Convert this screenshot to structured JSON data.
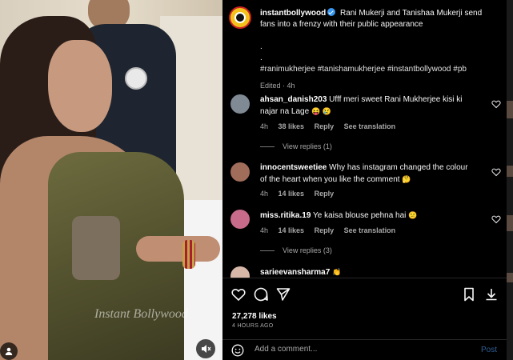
{
  "media": {
    "watermark": "Instant Bollywood"
  },
  "post": {
    "username": "instantbollywood",
    "caption": "Rani Mukerji and Tanishaa Mukerji send fans into a frenzy with their public appearance",
    "dots": [
      ".",
      "."
    ],
    "hashtags": "#ranimukherjee #tanishamukherjee #instantbollywood #pb",
    "edited": "Edited · 4h"
  },
  "comments": [
    {
      "username": "ahsan_danish203",
      "text": "Ufff meri sweet Rani Mukherjee kisi ki najar na Lage",
      "emoji": "😝 😢",
      "time": "4h",
      "likes": "38 likes",
      "reply": "Reply",
      "translate": "See translation",
      "view_replies": "View replies (1)",
      "avatar_color": "#7f8a95"
    },
    {
      "username": "innocentsweetiee",
      "text": "Why has instagram changed the colour of the heart when you like the comment",
      "emoji": "🤔",
      "time": "4h",
      "likes": "14 likes",
      "reply": "Reply",
      "avatar_color": "#a06d5a"
    },
    {
      "username": "miss.ritika.19",
      "text": "Ye kaisa blouse pehna hai",
      "emoji": "😕",
      "time": "4h",
      "likes": "14 likes",
      "reply": "Reply",
      "translate": "See translation",
      "view_replies": "View replies (3)",
      "avatar_color": "#c86a8a"
    },
    {
      "username": "sarieevansharma7",
      "emoji": "👏",
      "avatar_color": "#d6b7a8"
    }
  ],
  "actions": {
    "likes": "27,278 likes",
    "time_ago": "4 HOURS AGO",
    "add_comment_placeholder": "Add a comment...",
    "post_label": "Post"
  },
  "icons": [
    "heart-icon",
    "comment-icon",
    "share-icon",
    "bookmark-icon",
    "download-icon",
    "emoji-icon",
    "user-icon",
    "mute-icon",
    "verified-badge-icon"
  ],
  "colors": {
    "verified": "#3897f0",
    "post_button": "#2f5f93",
    "muted_text": "#a8a8a8",
    "background": "#000000"
  }
}
